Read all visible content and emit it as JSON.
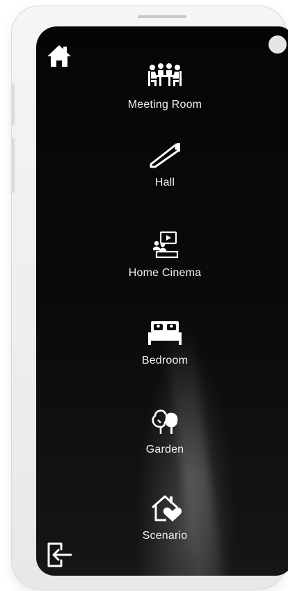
{
  "rooms": [
    {
      "id": "meeting-room",
      "label": "Meeting Room",
      "icon": "meeting-room-icon"
    },
    {
      "id": "hall",
      "label": "Hall",
      "icon": "hall-icon"
    },
    {
      "id": "home-cinema",
      "label": "Home Cinema",
      "icon": "home-cinema-icon"
    },
    {
      "id": "bedroom",
      "label": "Bedroom",
      "icon": "bed-icon"
    },
    {
      "id": "garden",
      "label": "Garden",
      "icon": "tree-icon"
    },
    {
      "id": "scenario",
      "label": "Scenario",
      "icon": "house-heart-icon"
    }
  ],
  "nav": {
    "home_icon": "home-icon",
    "exit_icon": "exit-icon"
  },
  "colors": {
    "screen_background": "#0b0b0b",
    "icon_color": "#ffffff",
    "label_color": "#f2f2f2",
    "device_frame": "#eeeeee"
  }
}
